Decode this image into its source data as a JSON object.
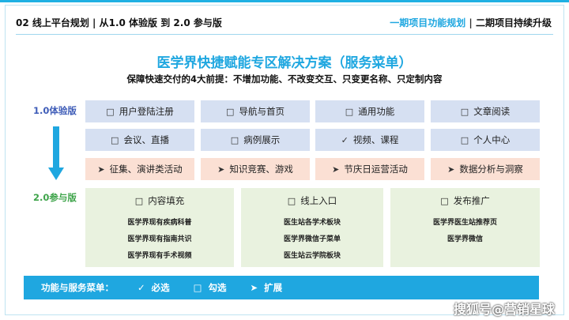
{
  "header": {
    "left": "02 线上平台规划 | 从1.0 体验版 到 2.0 参与版",
    "right_a": "一期项目功能规划",
    "right_sep": "|",
    "right_b": "二期项目持续升级"
  },
  "title": "医学界快捷赋能专区解决方案（服务菜单）",
  "subtitle": "保障快速交付的4大前提：不增加功能、不改变交互、只变更名称、只定制内容",
  "labels": {
    "v1": "1.0体验版",
    "v2": "2.0参与版"
  },
  "row1": [
    "用户登陆注册",
    "导航与首页",
    "通用功能",
    "文章阅读"
  ],
  "row2": [
    "会议、直播",
    "病例展示",
    "视频、课程",
    "个人中心"
  ],
  "row3": [
    "征集、演讲类活动",
    "知识竞赛、游戏",
    "节庆日运营活动",
    "数据分析与洞察"
  ],
  "groups": [
    {
      "title": "内容填充",
      "items": [
        "医学界现有疾病科普",
        "医学界现有指南共识",
        "医学界现有手术视频"
      ]
    },
    {
      "title": "线上入口",
      "items": [
        "医生站各学术板块",
        "医学界微信子菜单",
        "医生站云学院板块"
      ]
    },
    {
      "title": "发布推广",
      "items": [
        "医学界医生站推荐页",
        "医学界微信"
      ]
    }
  ],
  "bottom": {
    "label": "功能与服务菜单：",
    "must": "必选",
    "check": "勾选",
    "expand": "扩展"
  },
  "icons": {
    "square": "□",
    "check": "✓",
    "arrow": "➤"
  },
  "colors": {
    "accent": "#1fa7e0",
    "blue_cell": "#d6e0f2",
    "orange_cell": "#fbe0d4",
    "green_cell": "#e9f2df"
  },
  "watermark": "搜狐号@营销星球"
}
